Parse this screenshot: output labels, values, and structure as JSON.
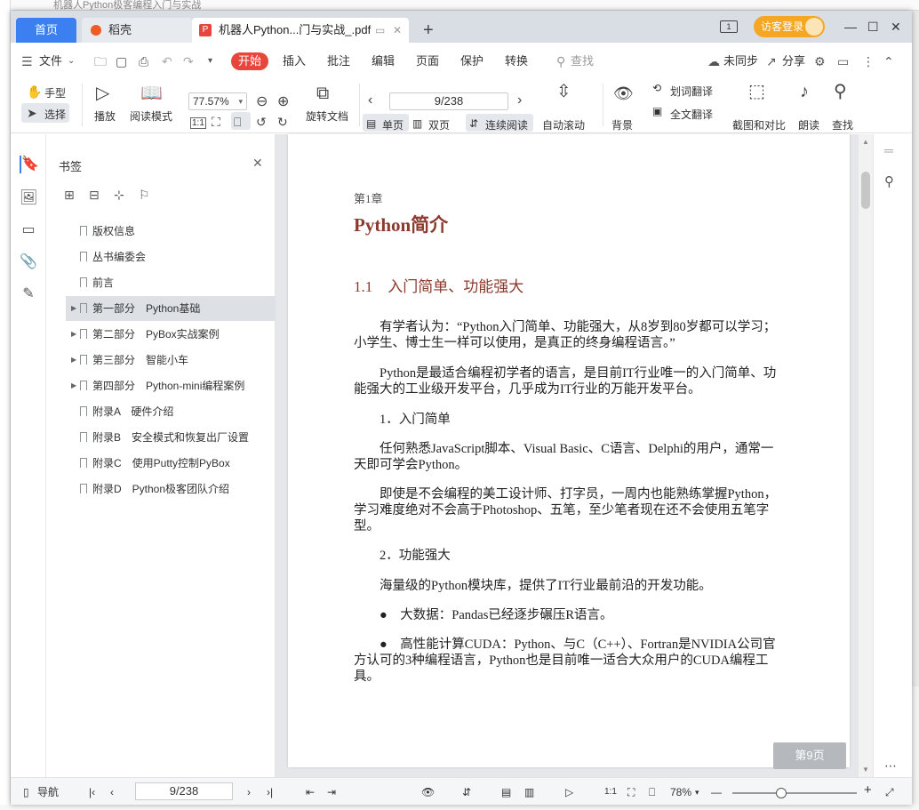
{
  "tabs": {
    "home": "首页",
    "daoke": "稻壳",
    "document": "机器人Python...门与实战_.pdf",
    "new_tab": "+"
  },
  "titlebar": {
    "guest_login": "访客登录",
    "box_indicator": "1"
  },
  "menu": {
    "file": "文件",
    "start": "开始",
    "insert": "插入",
    "annotate": "批注",
    "edit": "编辑",
    "page": "页面",
    "protect": "保护",
    "convert": "转换",
    "search_placeholder": "查找",
    "unsynced": "未同步",
    "share": "分享"
  },
  "ribbon": {
    "hand": "手型",
    "select": "选择",
    "play": "播放",
    "read_mode": "阅读模式",
    "zoom": "77.57%",
    "actual_size": "1:1",
    "rotate_doc": "旋转文档",
    "page_indicator": "9/238",
    "single_page": "单页",
    "double_page": "双页",
    "continuous": "连续阅读",
    "auto_scroll": "自动滚动",
    "background": "背景",
    "word_translate": "划词翻译",
    "full_translate": "全文翻译",
    "screenshot_compare": "截图和对比",
    "read_aloud": "朗读",
    "find": "查找"
  },
  "bookmark_panel": {
    "title": "书签",
    "items": [
      {
        "label": "版权信息",
        "expandable": false,
        "selected": false
      },
      {
        "label": "丛书编委会",
        "expandable": false,
        "selected": false
      },
      {
        "label": "前言",
        "expandable": false,
        "selected": false
      },
      {
        "label": "第一部分　Python基础",
        "expandable": true,
        "selected": true
      },
      {
        "label": "第二部分　PyBox实战案例",
        "expandable": true,
        "selected": false
      },
      {
        "label": "第三部分　智能小车",
        "expandable": true,
        "selected": false
      },
      {
        "label": "第四部分　Python-mini编程案例",
        "expandable": true,
        "selected": false
      },
      {
        "label": "附录A　硬件介绍",
        "expandable": false,
        "selected": false
      },
      {
        "label": "附录B　安全模式和恢复出厂设置",
        "expandable": false,
        "selected": false
      },
      {
        "label": "附录C　使用Putty控制PyBox",
        "expandable": false,
        "selected": false
      },
      {
        "label": "附录D　Python极客团队介绍",
        "expandable": false,
        "selected": false
      }
    ]
  },
  "document": {
    "chapter_number": "第1章",
    "chapter_title": "Python简介",
    "section_title": "1.1　入门简单、功能强大",
    "p1": "　　有学者认为：“Python入门简单、功能强大，从8岁到80岁都可以学习；小学生、博士生一样可以使用，是真正的终身编程语言。”",
    "p2": "　　Python是最适合编程初学者的语言，是目前IT行业唯一的入门简单、功能强大的工业级开发平台，几乎成为IT行业的万能开发平台。",
    "h1": "　　1．入门简单",
    "p3": "　　任何熟悉JavaScript脚本、Visual Basic、C语言、Delphi的用户，通常一天即可学会Python。",
    "p4": "　　即使是不会编程的美工设计师、打字员，一周内也能熟练掌握Python，学习难度绝对不会高于Photoshop、五笔，至少笔者现在还不会使用五笔字型。",
    "h2": "　　2．功能强大",
    "p5": "　　海量级的Python模块库，提供了IT行业最前沿的开发功能。",
    "b1": "　　●　大数据：Pandas已经逐步碾压R语言。",
    "b2": "　　●　高性能计算CUDA：Python、与C（C++）、Fortran是NVIDIA公司官方认可的3种编程语言，Python也是目前唯一适合大众用户的CUDA编程工具。",
    "page_badge": "第9页"
  },
  "statusbar": {
    "nav": "导航",
    "page": "9/238",
    "zoom": "78%",
    "zoom_level": 0.78
  },
  "desktop": {
    "title_fragment": "机器人Python极客编程入门与实战"
  },
  "colors": {
    "accent_blue": "#3c7ff0",
    "start_red": "#e8453c",
    "guest_orange": "#f5a623",
    "heading_brown": "#8b3a2e"
  }
}
